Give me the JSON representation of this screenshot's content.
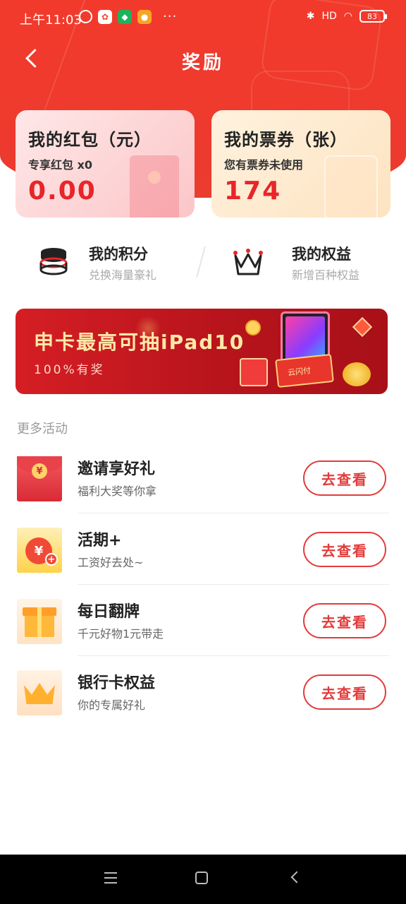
{
  "status_bar": {
    "time": "上午11:03",
    "battery": "83",
    "more": "···",
    "signal_label": "HD"
  },
  "nav": {
    "title": "奖励"
  },
  "cards": {
    "red_packet": {
      "title": "我的红包（元）",
      "subtitle": "专享红包 x0",
      "value": "0.00"
    },
    "tickets": {
      "title": "我的票券（张）",
      "subtitle": "您有票券未使用",
      "value": "174"
    }
  },
  "entries": {
    "points": {
      "title": "我的积分",
      "subtitle": "兑换海量豪礼"
    },
    "rights": {
      "title": "我的权益",
      "subtitle": "新增百种权益"
    }
  },
  "banner": {
    "title": "申卡最高可抽iPad10",
    "subtitle": "100%有奖",
    "box_label": "云闪付"
  },
  "more_section_title": "更多活动",
  "activities": [
    {
      "title": "邀请享好礼",
      "subtitle": "福利大奖等你拿",
      "button": "去查看",
      "icon_glyph": "¥"
    },
    {
      "title": "活期+",
      "subtitle": "工资好去处~",
      "button": "去查看",
      "icon_glyph": "¥"
    },
    {
      "title": "每日翻牌",
      "subtitle": "千元好物1元带走",
      "button": "去查看"
    },
    {
      "title": "银行卡权益",
      "subtitle": "你的专属好礼",
      "button": "去查看"
    }
  ],
  "colors": {
    "brand_red": "#ee3a2e",
    "value_red": "#e8252a",
    "button_red": "#e23b3b"
  }
}
